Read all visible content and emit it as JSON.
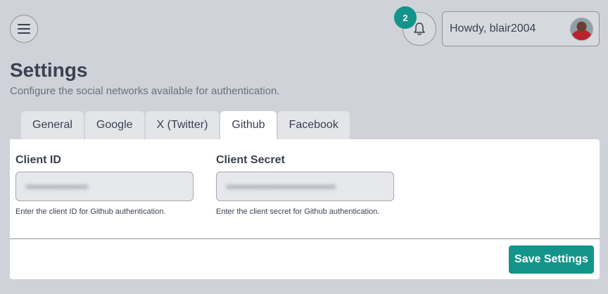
{
  "header": {
    "notification_count": "2",
    "greeting": "Howdy, blair2004"
  },
  "page": {
    "title": "Settings",
    "subtitle": "Configure the social networks available for authentication."
  },
  "tabs": [
    {
      "label": "General"
    },
    {
      "label": "Google"
    },
    {
      "label": "X (Twitter)"
    },
    {
      "label": "Github",
      "active": true
    },
    {
      "label": "Facebook"
    }
  ],
  "form": {
    "client_id": {
      "label": "Client ID",
      "value": "••••••••••••••••",
      "help": "Enter the client ID for Github authentication."
    },
    "client_secret": {
      "label": "Client Secret",
      "value": "••••••••••••••••••••••••••••",
      "help": "Enter the client secret for Github authentication."
    },
    "save_label": "Save Settings"
  },
  "colors": {
    "accent": "#13948a",
    "background": "#cfd2d8"
  },
  "icons": {
    "menu": "hamburger-menu-icon",
    "notifications": "bell-icon"
  }
}
